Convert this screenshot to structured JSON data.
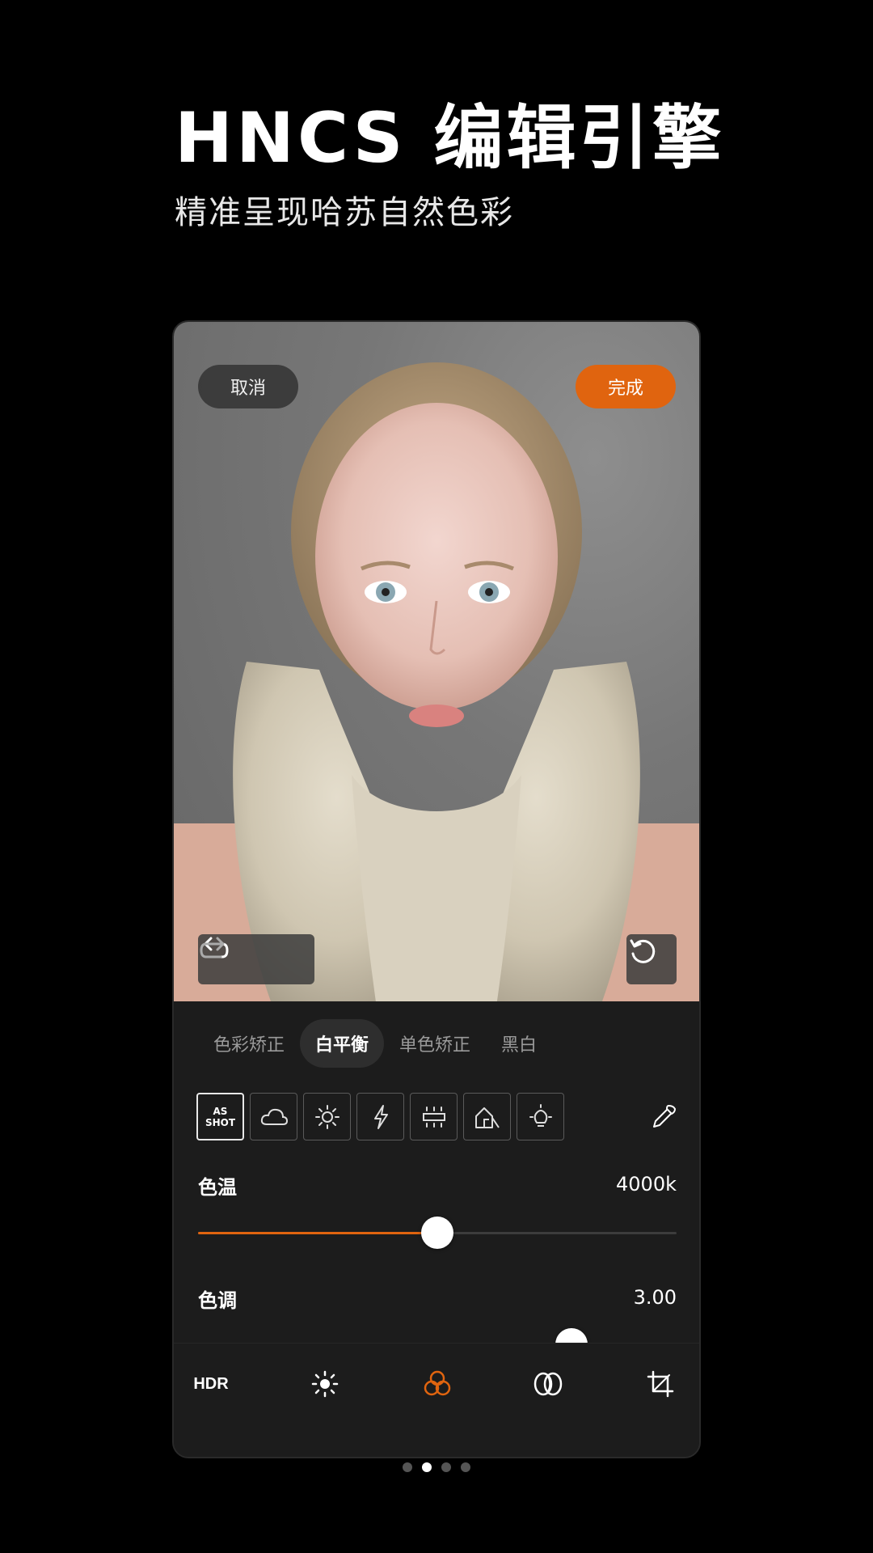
{
  "hero": {
    "title": "HNCS 编辑引擎",
    "subtitle": "精准呈现哈苏自然色彩"
  },
  "editor": {
    "cancel_label": "取消",
    "done_label": "完成",
    "tabs": [
      {
        "label": "色彩矫正",
        "active": false
      },
      {
        "label": "白平衡",
        "active": true
      },
      {
        "label": "单色矫正",
        "active": false
      },
      {
        "label": "黑白",
        "active": false
      }
    ],
    "presets": {
      "as_shot_line1": "AS",
      "as_shot_line2": "SHOT",
      "icons": [
        "cloud-icon",
        "sun-icon",
        "flash-icon",
        "fluorescent-icon",
        "shade-icon",
        "tungsten-icon"
      ]
    },
    "sliders": [
      {
        "label": "色温",
        "value": "4000k",
        "level": 0.5
      },
      {
        "label": "色调",
        "value": "3.00",
        "level": 0.78
      }
    ],
    "bottom_nav": {
      "hdr_label": "HDR",
      "items": [
        "hdr",
        "light-icon",
        "color-icon",
        "filter-icon",
        "crop-icon"
      ],
      "active": "color-icon"
    },
    "accent_color": "#e0640f"
  },
  "pager": {
    "count": 4,
    "active_index": 1
  }
}
